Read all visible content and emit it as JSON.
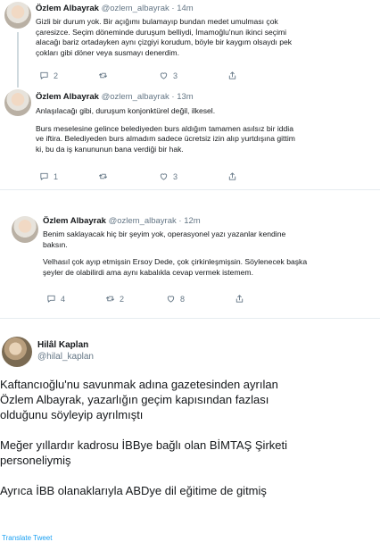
{
  "tweets": [
    {
      "name": "Özlem Albayrak",
      "handle": "@ozlem_albayrak",
      "sep": "·",
      "time": "14m",
      "lines": [
        "Gizli bir durum yok. Bir açığımı bulamayıp bundan medet umulması çok",
        "çaresizce. Seçim döneminde duruşum belliydi, İmamoğlu'nun ikinci seçimi",
        "alacağı bariz ortadayken aynı çizgiyi korudum, böyle bir kaygım olsaydı pek",
        "çokları gibi döner veya susmayı denerdim."
      ],
      "replies": "2",
      "retweets": "",
      "likes": "3"
    },
    {
      "name": "Özlem Albayrak",
      "handle": "@ozlem_albayrak",
      "sep": "·",
      "time": "13m",
      "lines": [
        "Anlaşılacağı gibi, duruşum konjonktürel değil, ilkesel.",
        "",
        "Burs meselesine gelince belediyeden burs aldığım tamamen asılsız bir iddia",
        "ve iftira. Belediyeden burs almadım sadece ücretsiz izin alıp yurtdışına gittim",
        "ki, bu da iş kanununun bana verdiği bir hak."
      ],
      "replies": "1",
      "retweets": "",
      "likes": "3"
    },
    {
      "name": "Özlem Albayrak",
      "handle": "@ozlem_albayrak",
      "sep": "·",
      "time": "12m",
      "lines": [
        "Benim saklayacak hiç bir şeyim yok, operasyonel yazı yazanlar kendine",
        "baksın.",
        "",
        "Velhasıl çok ayıp etmişsin Ersoy Dede, çok çirkinleşmişsin. Söylenecek başka",
        "şeyler de olabilirdi ama aynı kabalıkla cevap vermek istemem."
      ],
      "replies": "4",
      "retweets": "2",
      "likes": "8"
    }
  ],
  "big_tweet": {
    "name": "Hilâl Kaplan",
    "handle": "@hilal_kaplan",
    "lines": [
      "Kaftancıoğlu'nu savunmak adına gazetesinden ayrılan",
      "Özlem Albayrak, yazarlığın geçim kapısından fazlası",
      "olduğunu söyleyip ayrılmıştı",
      "",
      "Meğer yıllardır kadrosu İBBye bağlı olan BİMTAŞ Şirketi",
      "personeliymiş",
      "",
      "Ayrıca İBB olanaklarıyla ABDye dil eğitime de gitmiş"
    ],
    "translate": "Translate Tweet"
  },
  "icons": {
    "reply": "reply-icon",
    "retweet": "retweet-icon",
    "like": "heart-icon",
    "share": "share-icon"
  },
  "colors": {
    "muted": "#657786",
    "link": "#1da1f2",
    "divider": "#e6ecf0"
  }
}
